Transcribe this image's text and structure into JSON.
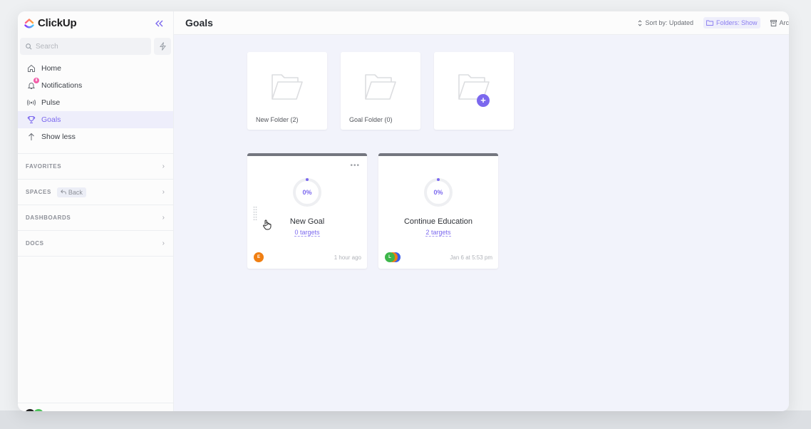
{
  "app": {
    "name": "ClickUp",
    "brand_color": "#7b68ee"
  },
  "sidebar": {
    "collapse_icon": "double-chevron-left-icon",
    "search": {
      "placeholder": "Search",
      "value": ""
    },
    "quick_action_icon": "bolt-icon",
    "nav": [
      {
        "label": "Home",
        "icon": "home-icon",
        "active": false
      },
      {
        "label": "Notifications",
        "icon": "bell-icon",
        "active": false,
        "badge": "8"
      },
      {
        "label": "Pulse",
        "icon": "pulse-icon",
        "active": false
      },
      {
        "label": "Goals",
        "icon": "trophy-icon",
        "active": true
      },
      {
        "label": "Show less",
        "icon": "arrow-up-icon",
        "active": false
      }
    ],
    "sections": [
      {
        "label": "FAVORITES"
      },
      {
        "label": "SPACES",
        "chip": "Back"
      },
      {
        "label": "DASHBOARDS"
      },
      {
        "label": "DOCS"
      }
    ]
  },
  "header": {
    "title": "Goals",
    "toolbar": {
      "sort_label": "Sort by: Updated",
      "folders_label": "Folders: Show",
      "archive_label": "Arc"
    }
  },
  "folders": [
    {
      "name": "New Folder (2)"
    },
    {
      "name": "Goal Folder (0)"
    },
    {
      "name": "",
      "type": "add-folder"
    }
  ],
  "goals": [
    {
      "name": "New Goal",
      "progress_percent": 0,
      "progress_label": "0%",
      "targets_label": "0 targets",
      "updated": "1 hour ago",
      "owners": [
        {
          "initial": "E",
          "color": "#f07f13"
        }
      ]
    },
    {
      "name": "Continue Education",
      "progress_percent": 0,
      "progress_label": "0%",
      "targets_label": "2 targets",
      "updated": "Jan 6 at 5:53 pm",
      "owners": [
        {
          "initial": "L",
          "color": "#3db64a"
        },
        {
          "initial": "",
          "color": "#f07f13"
        },
        {
          "initial": "",
          "color": "#3a5ee8"
        }
      ]
    }
  ]
}
